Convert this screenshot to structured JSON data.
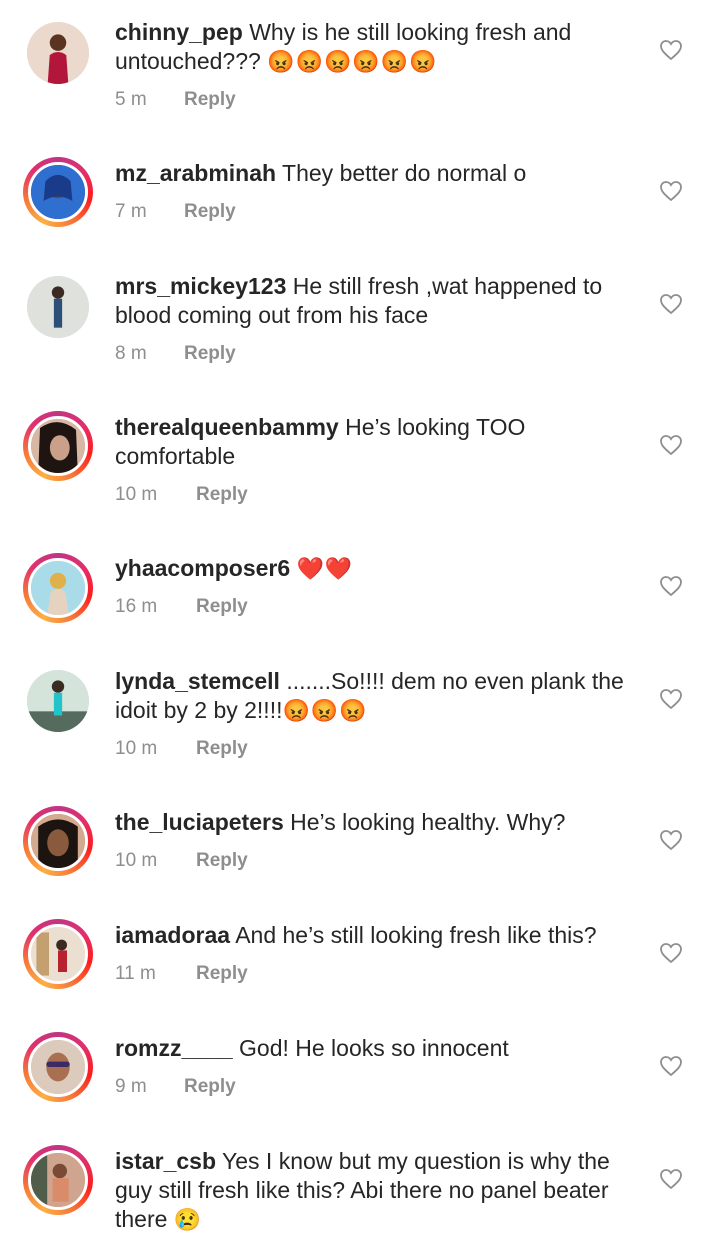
{
  "comments": [
    {
      "username": "chinny_pep",
      "text": "Why is he still looking fresh and untouched???",
      "emoji": "😡😡😡😡😡😡",
      "time": "5 m",
      "reply": "Reply",
      "story": false
    },
    {
      "username": "mz_arabminah",
      "text": "They better do normal o",
      "emoji": "",
      "time": "7 m",
      "reply": "Reply",
      "story": true
    },
    {
      "username": "mrs_mickey123",
      "text": "He still fresh ,wat happened to blood coming out from his face",
      "emoji": "",
      "time": "8 m",
      "reply": "Reply",
      "story": false
    },
    {
      "username": "therealqueenbammy",
      "text": "He’s looking TOO comfortable",
      "emoji": "",
      "time": "10 m",
      "reply": "Reply",
      "story": true
    },
    {
      "username": "yhaacomposer6",
      "text": "",
      "emoji": "❤️❤️",
      "time": "16 m",
      "reply": "Reply",
      "story": true
    },
    {
      "username": "lynda_stemcell",
      "text": ".......So!!!! dem no  even plank the idoit by 2 by 2!!!!",
      "emoji": "😡😡😡",
      "time": "10 m",
      "reply": "Reply",
      "story": false
    },
    {
      "username": "the_luciapeters",
      "text": "He’s looking healthy. Why?",
      "emoji": "",
      "time": "10 m",
      "reply": "Reply",
      "story": true
    },
    {
      "username": "iamadoraa",
      "text": "And he’s still looking fresh like this?",
      "emoji": "",
      "time": "11 m",
      "reply": "Reply",
      "story": true
    },
    {
      "username": "romzz____",
      "text": "God! He looks so innocent",
      "emoji": "",
      "time": "9 m",
      "reply": "Reply",
      "story": true
    },
    {
      "username": "istar_csb",
      "text": "Yes I know but my question is why the guy still fresh like this? Abi there no panel beater there",
      "emoji": "😢",
      "time": "",
      "reply": "",
      "story": true
    }
  ],
  "icons": {
    "like": "heart-outline-icon"
  },
  "colors": {
    "text": "#262626",
    "muted": "#8e8e8e",
    "story_ring": "#e1306c"
  }
}
